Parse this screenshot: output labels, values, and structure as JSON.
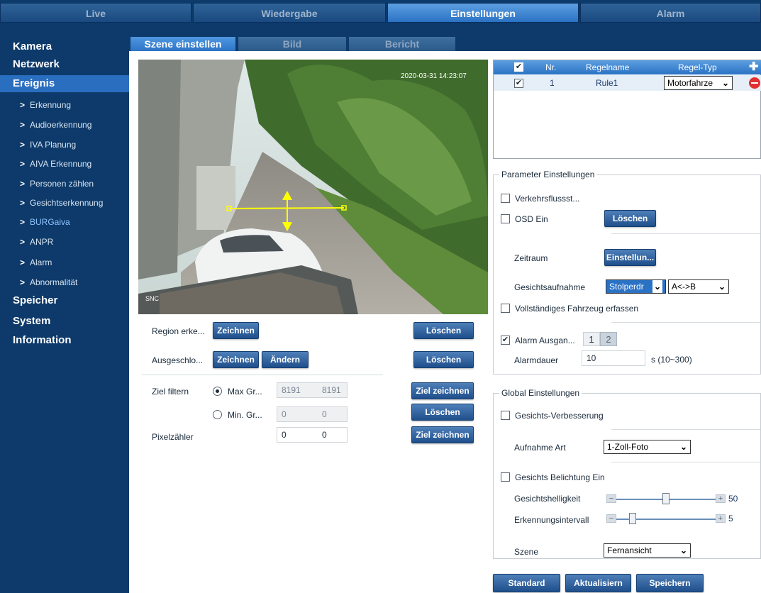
{
  "topnav": {
    "tabs": [
      "Live",
      "Wiedergabe",
      "Einstellungen",
      "Alarm"
    ]
  },
  "sidebar": {
    "main": [
      "Kamera",
      "Netzwerk",
      "Ereignis",
      "Speicher",
      "System",
      "Information"
    ],
    "sub": [
      "Erkennung",
      "Audioerkennung",
      "IVA Planung",
      "AIVA Erkennung",
      "Personen zählen",
      "Gesichtserkennung",
      "BURGaiva",
      "ANPR",
      "Alarm",
      "Abnormalität"
    ]
  },
  "subtabs": [
    "Szene einstellen",
    "Bild",
    "Bericht"
  ],
  "camera": {
    "osd_time": "2020-03-31 14:23:07",
    "osd_label": "SNC"
  },
  "region": {
    "label": "Region erke...",
    "draw": "Zeichnen",
    "delete": "Löschen"
  },
  "excluded": {
    "label": "Ausgeschlo...",
    "draw": "Zeichnen",
    "edit": "Ändern",
    "delete": "Löschen"
  },
  "target_filter": {
    "label": "Ziel filtern",
    "max_label": "Max Gr...",
    "max_w": "8191",
    "max_h": "8191",
    "min_label": "Min. Gr...",
    "min_w": "0",
    "min_h": "0",
    "times": "*",
    "draw_target": "Ziel zeichnen",
    "delete": "Löschen"
  },
  "pixel_counter": {
    "label": "Pixelzähler",
    "w": "0",
    "h": "0",
    "draw_target": "Ziel zeichnen"
  },
  "rules": {
    "headers": [
      "Nr.",
      "Regelname",
      "Regel-Typ"
    ],
    "rows": [
      {
        "nr": "1",
        "name": "Rule1",
        "type": "Motorfahrze"
      }
    ]
  },
  "params": {
    "title": "Parameter Einstellungen",
    "traffic_flow": "Verkehrsflussst...",
    "osd": "OSD Ein",
    "osd_clear": "Löschen",
    "period_label": "Zeitraum",
    "period_btn": "Einstellun...",
    "face_capture_label": "Gesichtsaufnahme",
    "face_capture_value": "Stolperdr",
    "face_capture_dir": "A<->B",
    "full_vehicle": "Vollständiges Fahrzeug erfassen",
    "alarm_output": "Alarm Ausgan...",
    "alarm_channels": [
      "1",
      "2"
    ],
    "alarm_duration_label": "Alarmdauer",
    "alarm_duration_value": "10",
    "alarm_duration_unit": "s (10~300)"
  },
  "global": {
    "title": "Global Einstellungen",
    "face_enhance": "Gesichts-Verbesserung",
    "capture_type_label": "Aufnahme Art",
    "capture_type_value": "1-Zoll-Foto",
    "face_exposure": "Gesichts Belichtung Ein",
    "brightness_label": "Gesichtshelligkeit",
    "brightness_value": "50",
    "brightness_level": 50,
    "interval_label": "Erkennungsintervall",
    "interval_value": "5",
    "interval_level": 5,
    "scene_label": "Szene",
    "scene_value": "Fernansicht"
  },
  "footer": {
    "default": "Standard",
    "refresh": "Aktualisiern",
    "save": "Speichern"
  },
  "colors": {
    "nav_bg": "#0d3a6a",
    "accent": "#2a72c4",
    "rule_line": "#ffff00",
    "delete_red": "#e03030",
    "add_blue": "#3a9cf0"
  }
}
